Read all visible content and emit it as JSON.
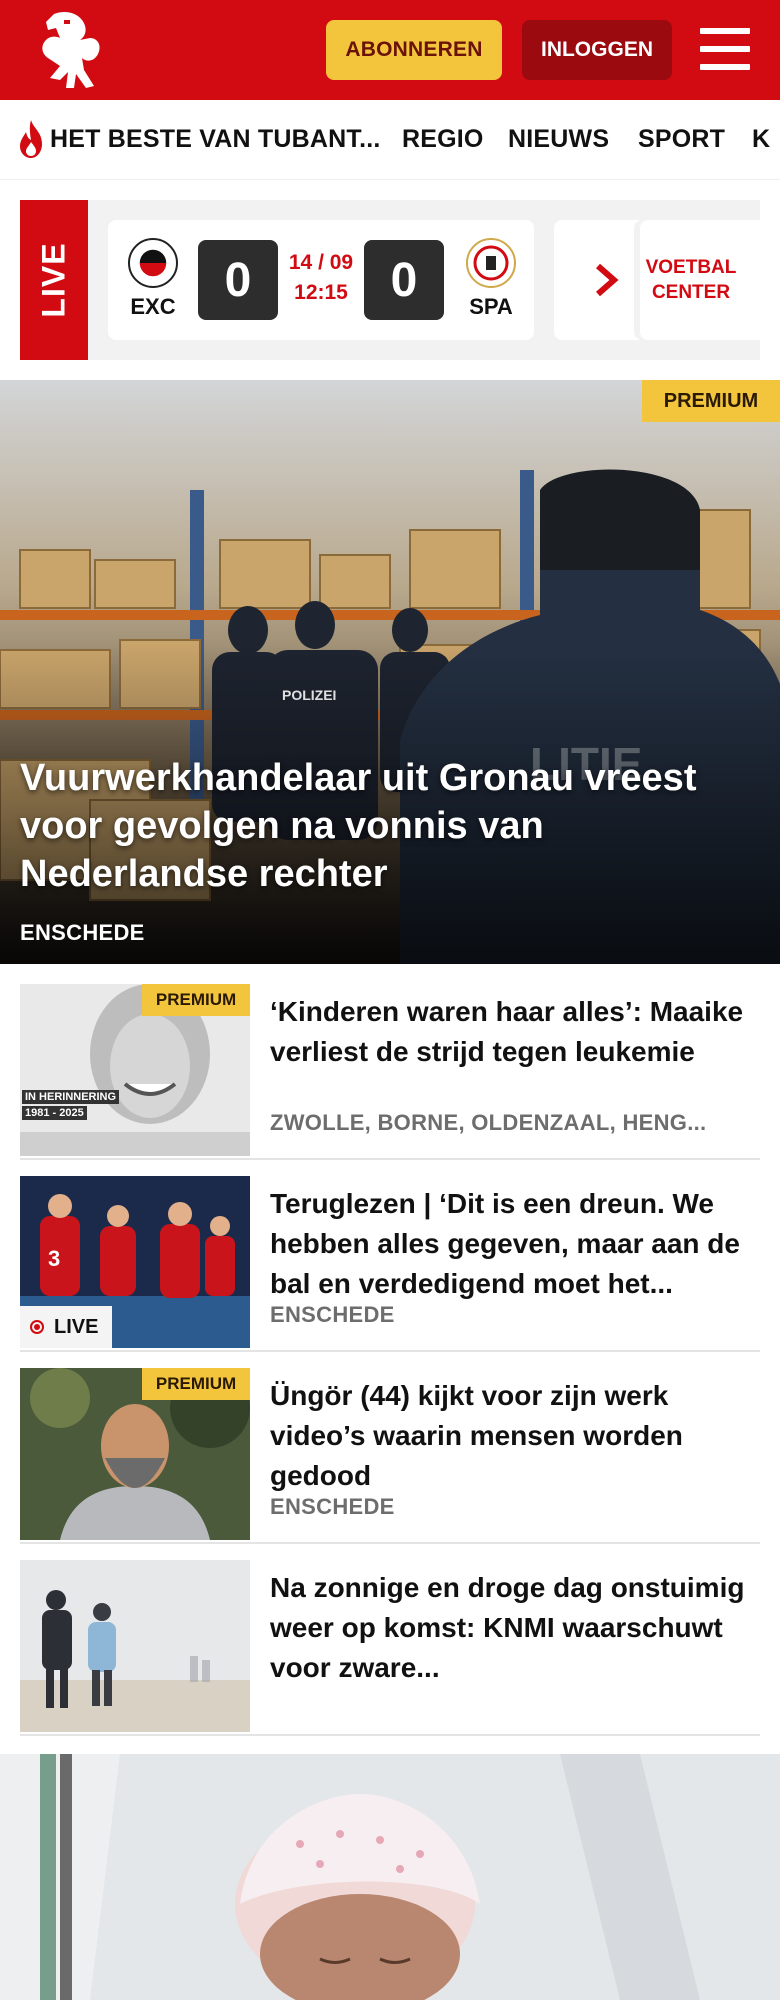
{
  "header": {
    "logo": "horse-logo-icon",
    "subscribe_label": "ABONNEREN",
    "login_label": "INLOGGEN",
    "colors": {
      "brand_red": "#d20a11",
      "subscribe_yellow": "#f2c53d",
      "login_dark_red": "#9a0a0f"
    }
  },
  "nav": {
    "items": [
      {
        "label": "HET BESTE VAN TUBANT...",
        "icon": "flame-icon"
      },
      {
        "label": "REGIO"
      },
      {
        "label": "NIEUWS"
      },
      {
        "label": "SPORT"
      },
      {
        "label": "K"
      }
    ]
  },
  "live": {
    "badge": "LIVE",
    "match": {
      "home_code": "EXC",
      "home_score": "0",
      "date": "14 / 09",
      "time": "12:15",
      "away_score": "0",
      "away_code": "SPA"
    },
    "voetbal_center": "VOETBAL CENTER"
  },
  "hero": {
    "premium": "PREMIUM",
    "title": "Vuurwerkhandelaar uit Gronau vreest voor gevolgen na vonnis van Nederlandse rechter",
    "location": "ENSCHEDE"
  },
  "articles": [
    {
      "title": "‘Kinderen waren haar alles’: Maaike verliest de strijd tegen leukemie",
      "location": "ZWOLLE, BORNE, OLDENZAAL, HENG...",
      "premium": "PREMIUM",
      "thumb_caption_1": "IN HERINNERING",
      "thumb_caption_2": "1981 - 2025"
    },
    {
      "title": "Teruglezen | ‘Dit is een dreun. We hebben alles gegeven, maar aan de bal en verdedigend moet het...",
      "location": "ENSCHEDE",
      "live_label": "LIVE"
    },
    {
      "title": "Üngör (44) kijkt voor zijn werk video’s waarin mensen worden gedood",
      "location": "ENSCHEDE",
      "premium": "PREMIUM"
    },
    {
      "title": "Na zonnige en droge dag onstuimig weer op komst: KNMI waarschuwt voor zware...",
      "location": ""
    }
  ]
}
